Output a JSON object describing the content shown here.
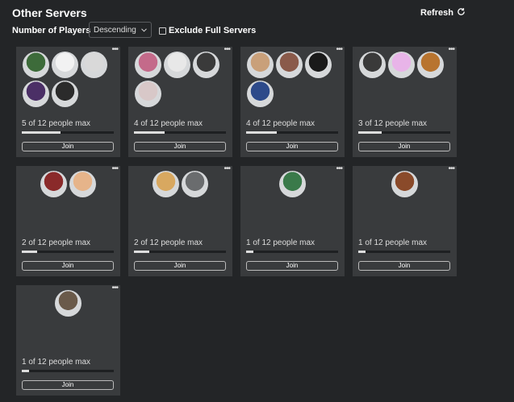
{
  "header": {
    "title": "Other Servers",
    "refresh_label": "Refresh"
  },
  "filters": {
    "sort_label": "Number of Players",
    "sort_value": "Descending",
    "exclude_label": "Exclude Full Servers",
    "exclude_checked": false
  },
  "servers": [
    {
      "players": 5,
      "count_text": "5 of 12 people max",
      "join_label": "Join",
      "fill": 0.4167,
      "avatar_colors": [
        "#3d6b3a",
        "#f2f2f2",
        "#d9d9d9",
        "#4b2f66",
        "#2b2b2b"
      ]
    },
    {
      "players": 4,
      "count_text": "4 of 12 people max",
      "join_label": "Join",
      "fill": 0.3333,
      "avatar_colors": [
        "#c46a8a",
        "#e8e8e8",
        "#3a3a3a",
        "#d8c8c8"
      ]
    },
    {
      "players": 4,
      "count_text": "4 of 12 people max",
      "join_label": "Join",
      "fill": 0.3333,
      "avatar_colors": [
        "#c9a07a",
        "#8a5a4a",
        "#1a1a1a",
        "#2d4a8a"
      ]
    },
    {
      "players": 3,
      "count_text": "3 of 12 people max",
      "join_label": "Join",
      "fill": 0.25,
      "avatar_colors": [
        "#3a3a3a",
        "#e8b4e8",
        "#b8742f"
      ]
    },
    {
      "players": 2,
      "count_text": "2 of 12 people max",
      "join_label": "Join",
      "fill": 0.1667,
      "avatar_colors": [
        "#8a2a2a",
        "#e6b48a"
      ]
    },
    {
      "players": 2,
      "count_text": "2 of 12 people max",
      "join_label": "Join",
      "fill": 0.1667,
      "avatar_colors": [
        "#d8a860",
        "#6a6c6e"
      ]
    },
    {
      "players": 1,
      "count_text": "1 of 12 people max",
      "join_label": "Join",
      "fill": 0.0833,
      "avatar_colors": [
        "#3a7a4a"
      ]
    },
    {
      "players": 1,
      "count_text": "1 of 12 people max",
      "join_label": "Join",
      "fill": 0.0833,
      "avatar_colors": [
        "#8a4a2a"
      ]
    },
    {
      "players": 1,
      "count_text": "1 of 12 people max",
      "join_label": "Join",
      "fill": 0.0833,
      "avatar_colors": [
        "#6a5a4a"
      ]
    }
  ]
}
